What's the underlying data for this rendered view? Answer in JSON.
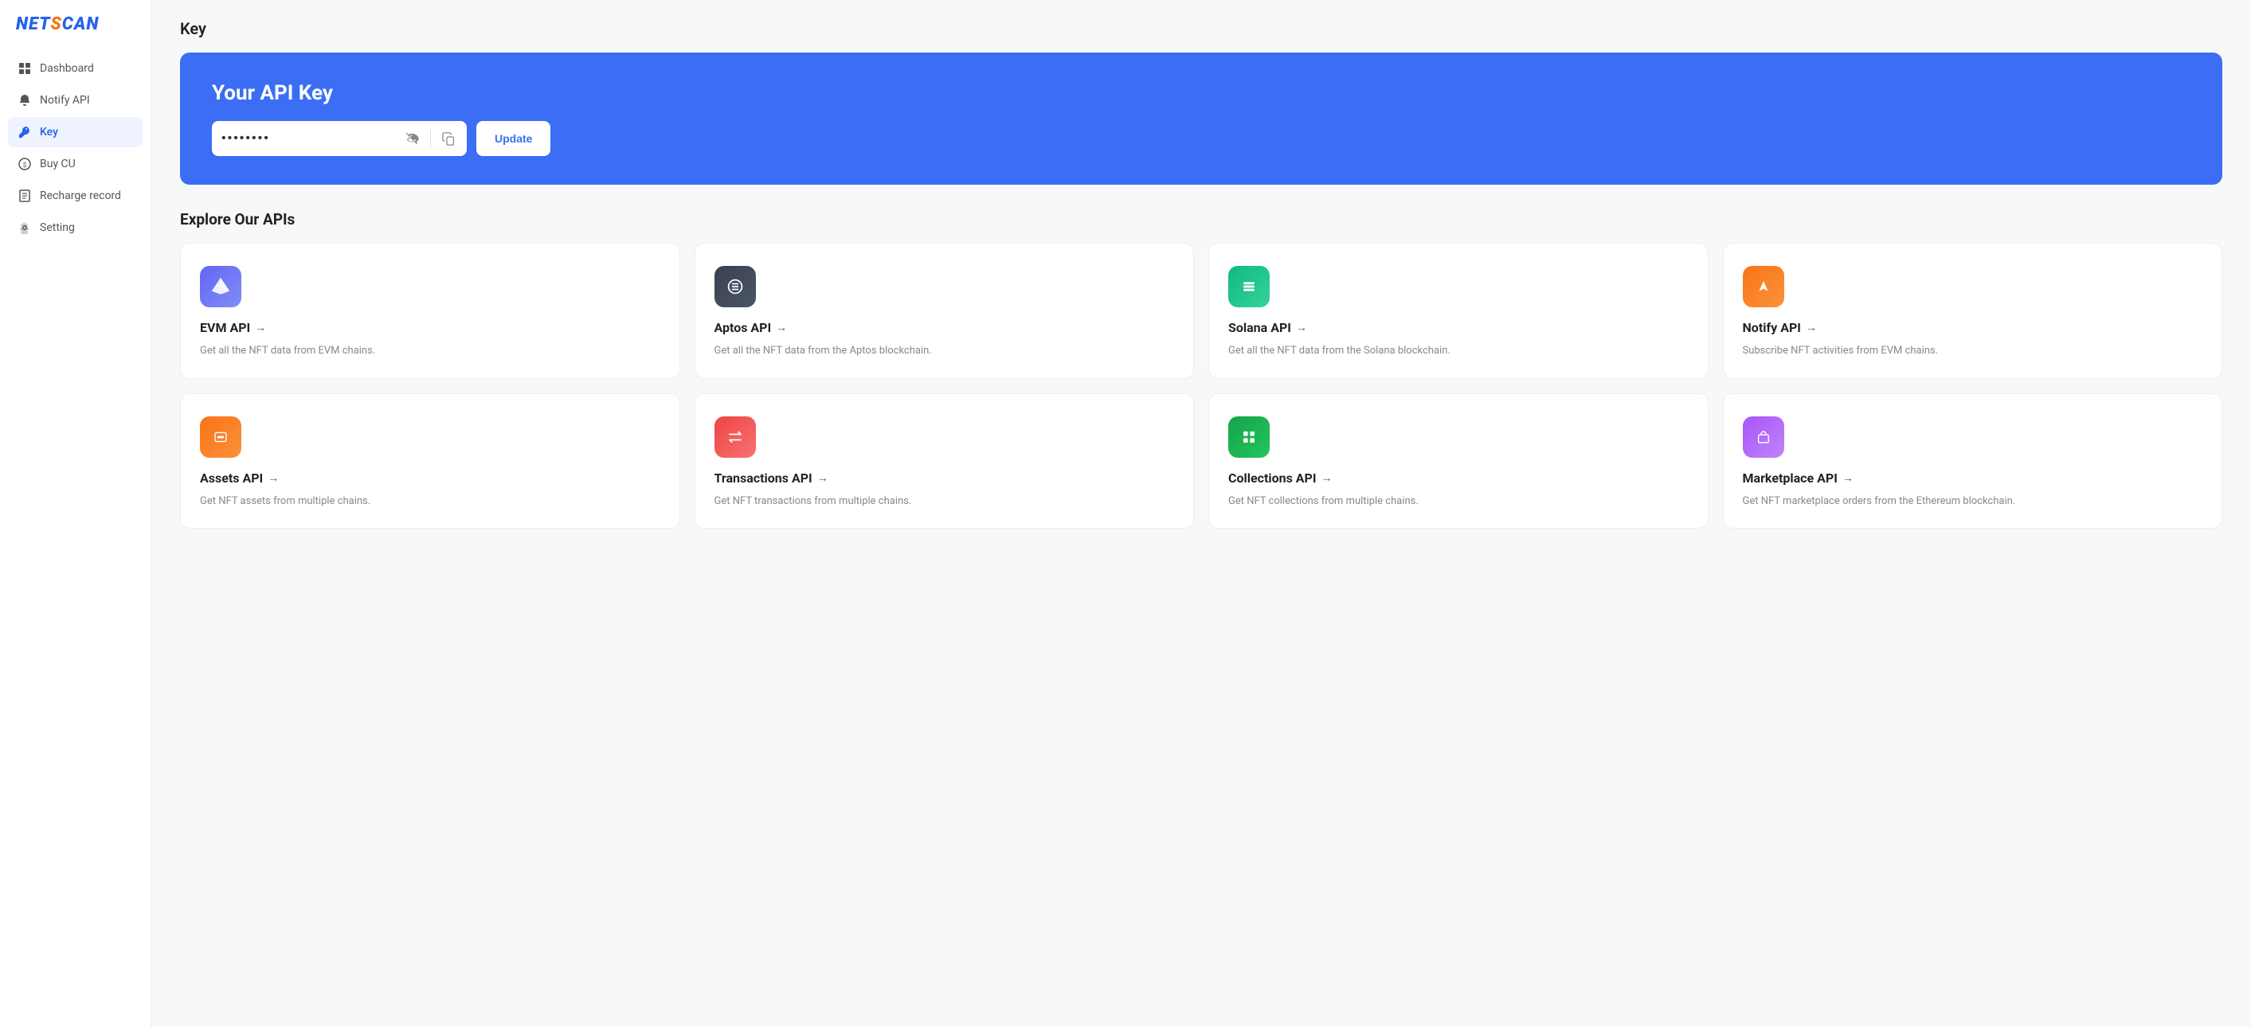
{
  "sidebar": {
    "logo": "NETSCAN",
    "items": [
      {
        "id": "dashboard",
        "label": "Dashboard",
        "icon": "grid"
      },
      {
        "id": "notify-api",
        "label": "Notify API",
        "icon": "bell"
      },
      {
        "id": "key",
        "label": "Key",
        "icon": "key",
        "active": true
      },
      {
        "id": "buy-cu",
        "label": "Buy CU",
        "icon": "tag"
      },
      {
        "id": "recharge-record",
        "label": "Recharge record",
        "icon": "receipt"
      },
      {
        "id": "setting",
        "label": "Setting",
        "icon": "gear"
      }
    ]
  },
  "page": {
    "title": "Key",
    "banner": {
      "title": "Your API Key",
      "key_placeholder": "••••••••",
      "update_label": "Update"
    },
    "explore": {
      "section_title": "Explore Our APIs",
      "apis": [
        {
          "id": "evm",
          "name": "EVM API",
          "desc": "Get all the NFT data from EVM chains.",
          "icon_class": "icon-evm"
        },
        {
          "id": "aptos",
          "name": "Aptos API",
          "desc": "Get all the NFT data from the Aptos blockchain.",
          "icon_class": "icon-aptos"
        },
        {
          "id": "solana",
          "name": "Solana API",
          "desc": "Get all the NFT data from the Solana blockchain.",
          "icon_class": "icon-solana"
        },
        {
          "id": "notify",
          "name": "Notify API",
          "desc": "Subscribe NFT activities from EVM chains.",
          "icon_class": "icon-notify"
        },
        {
          "id": "assets",
          "name": "Assets API",
          "desc": "Get NFT assets from multiple chains.",
          "icon_class": "icon-assets"
        },
        {
          "id": "transactions",
          "name": "Transactions API",
          "desc": "Get NFT transactions from multiple chains.",
          "icon_class": "icon-transactions"
        },
        {
          "id": "collections",
          "name": "Collections API",
          "desc": "Get NFT collections from multiple chains.",
          "icon_class": "icon-collections"
        },
        {
          "id": "marketplace",
          "name": "Marketplace API",
          "desc": "Get NFT marketplace orders from the Ethereum blockchain.",
          "icon_class": "icon-marketplace"
        }
      ]
    }
  }
}
